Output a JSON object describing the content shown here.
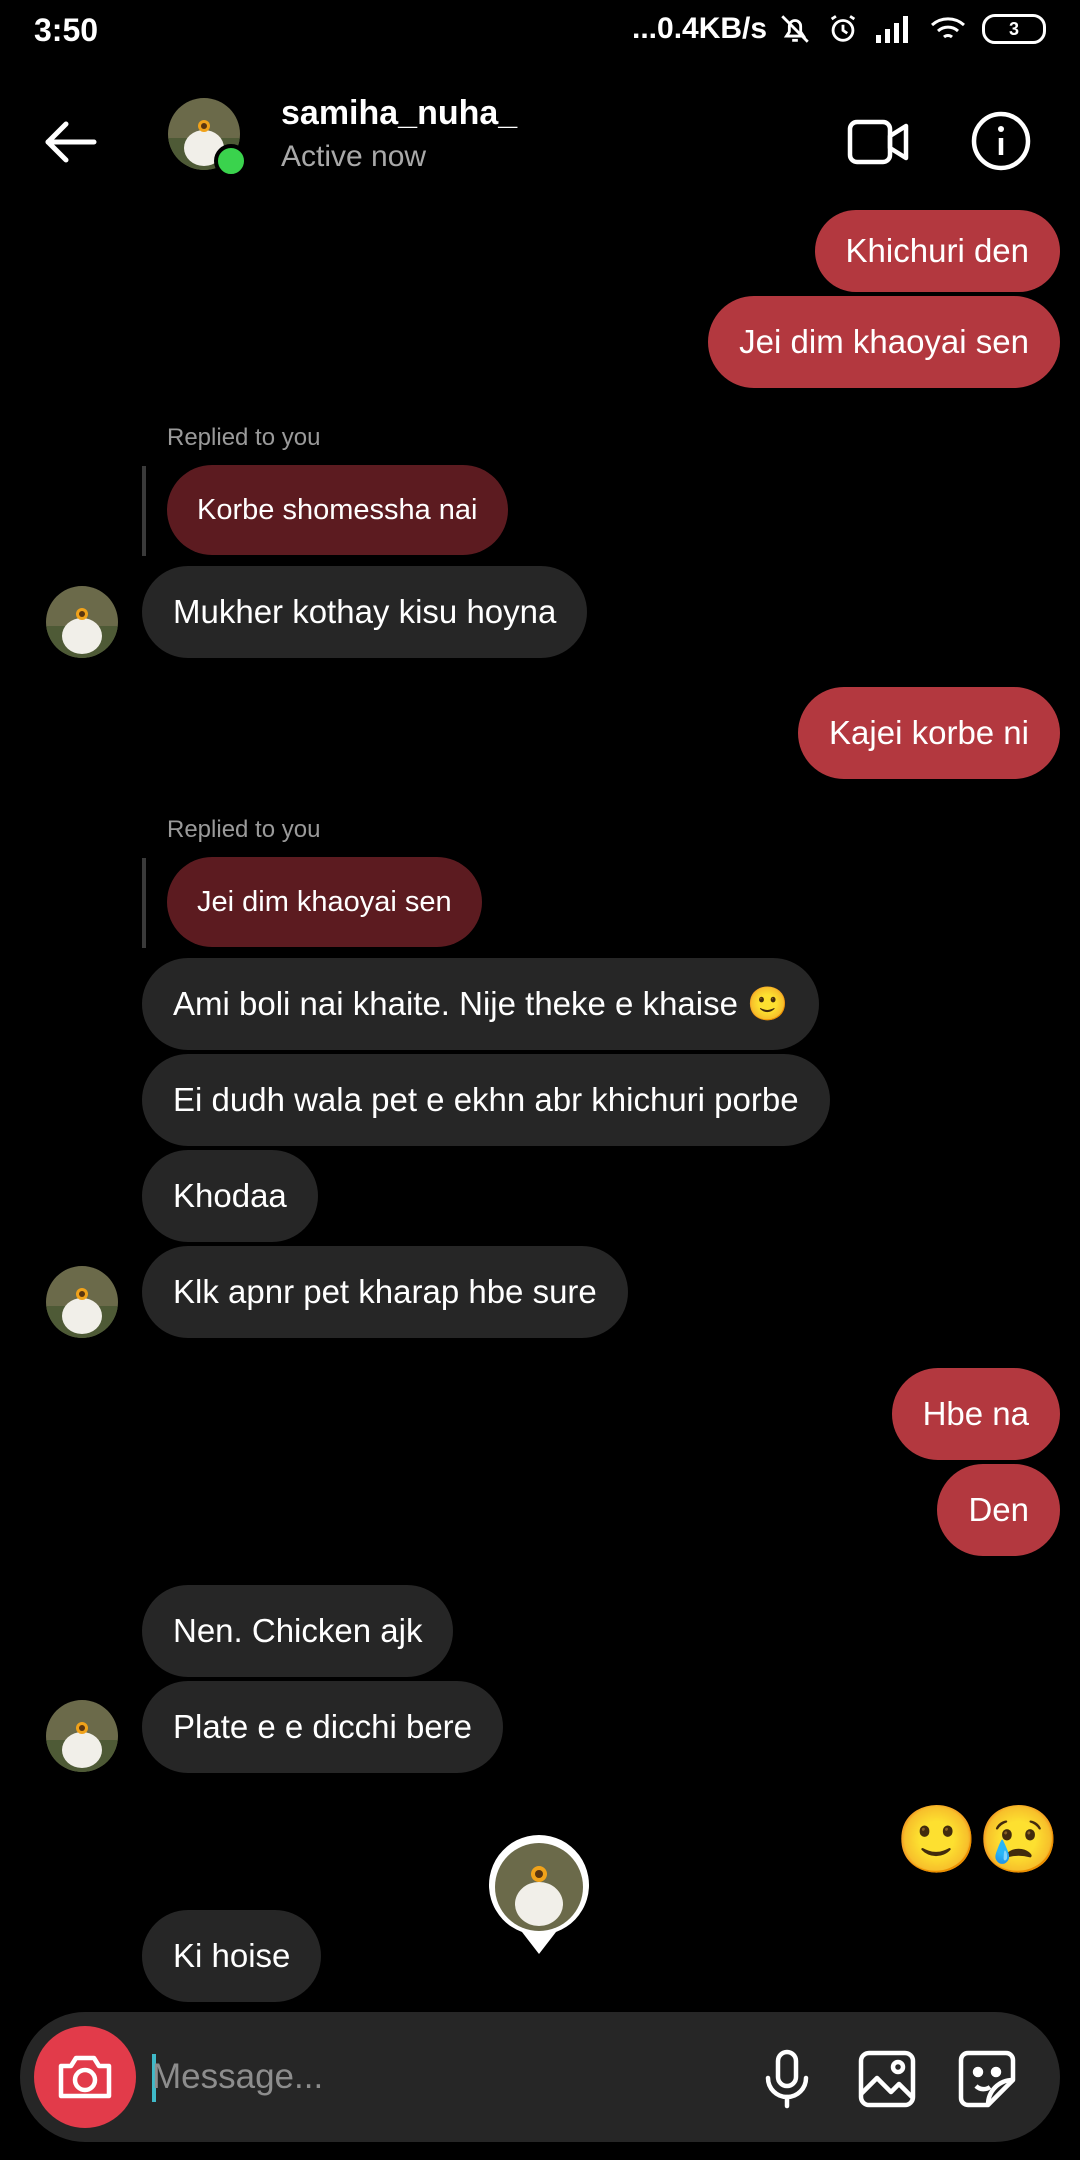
{
  "status_bar": {
    "time": "3:50",
    "network": "...0.4KB/s",
    "battery": "3"
  },
  "header": {
    "name": "samiha_nuha_",
    "status": "Active now"
  },
  "icons": {
    "back": "arrow-left-icon",
    "video": "video-camera-icon",
    "info": "info-circle-icon",
    "camera": "camera-icon",
    "mic": "microphone-icon",
    "gallery": "image-icon",
    "sticker": "sticker-icon"
  },
  "colors": {
    "outgoing_bubble": "#b3383f",
    "incoming_bubble": "#262626",
    "reply_bubble": "#5c1b20",
    "online": "#3ad34d",
    "camera_button": "#e23b4a"
  },
  "messages": [
    {
      "dir": "out",
      "text": "Khichuri den"
    },
    {
      "dir": "out",
      "text": "Jei dim khaoyai sen"
    },
    {
      "dir": "in",
      "reply_label": "Replied to you",
      "replied_text": "Korbe shomessha nai",
      "text": "Mukher kothay kisu hoyna"
    },
    {
      "dir": "out",
      "text": "Kajei korbe ni"
    },
    {
      "dir": "in",
      "reply_label": "Replied to you",
      "replied_text": "Jei dim khaoyai sen",
      "text": "Ami boli nai khaite. Nije theke e khaise 🙂"
    },
    {
      "dir": "in",
      "text": "Ei dudh wala pet e ekhn abr khichuri porbe"
    },
    {
      "dir": "in",
      "text": "Khodaa"
    },
    {
      "dir": "in",
      "text": "Klk apnr pet kharap hbe sure"
    },
    {
      "dir": "out",
      "text": "Hbe na"
    },
    {
      "dir": "out",
      "text": "Den"
    },
    {
      "dir": "in",
      "text": "Nen. Chicken ajk"
    },
    {
      "dir": "in",
      "text": "Plate e e dicchi bere"
    },
    {
      "dir": "out",
      "emojis": "🙂😢"
    },
    {
      "dir": "in",
      "text": "Ki hoise"
    }
  ],
  "composer": {
    "placeholder": "Message..."
  }
}
